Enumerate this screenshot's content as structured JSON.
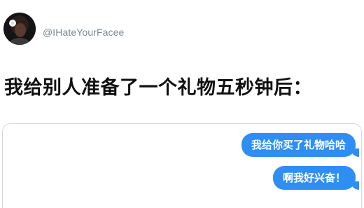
{
  "post": {
    "avatar_icon": "user-avatar-icon",
    "handle": "@IHateYourFacee",
    "headline": "我给别人准备了一个礼物五秒钟后："
  },
  "chat": {
    "messages": [
      {
        "text": "我给你买了礼物哈哈",
        "side": "right"
      },
      {
        "text": "啊我好兴奋！",
        "side": "right"
      }
    ],
    "bubble_color": "#2f8ef3"
  }
}
